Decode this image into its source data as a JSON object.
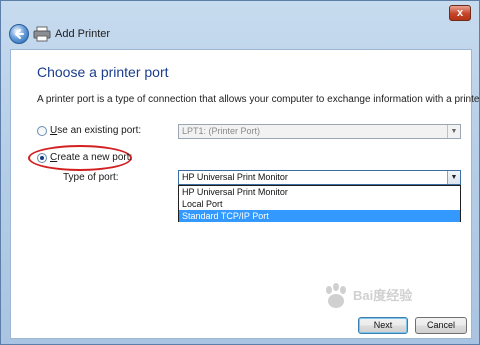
{
  "window": {
    "title": "Add Printer",
    "close_label": "x"
  },
  "page": {
    "heading": "Choose a printer port",
    "description": "A printer port is a type of connection that allows your computer to exchange information with a printer."
  },
  "options": {
    "existing_port": {
      "label_prefix": "U",
      "label_rest": "se an existing port:",
      "value": "LPT1: (Printer Port)",
      "checked": false
    },
    "new_port": {
      "label_prefix": "C",
      "label_rest": "reate a new port:",
      "checked": true
    },
    "type_of_port": {
      "label": "Type of port:",
      "value": "HP Universal Print Monitor",
      "options": [
        "HP Universal Print Monitor",
        "Local Port",
        "Standard TCP/IP Port"
      ],
      "highlighted_index": 2
    }
  },
  "buttons": {
    "next": "Next",
    "cancel": "Cancel"
  },
  "watermark": {
    "text": "Bai度经验"
  },
  "colors": {
    "heading": "#1a3e8c",
    "highlight_ring": "#d22020",
    "selection": "#3399ff"
  }
}
